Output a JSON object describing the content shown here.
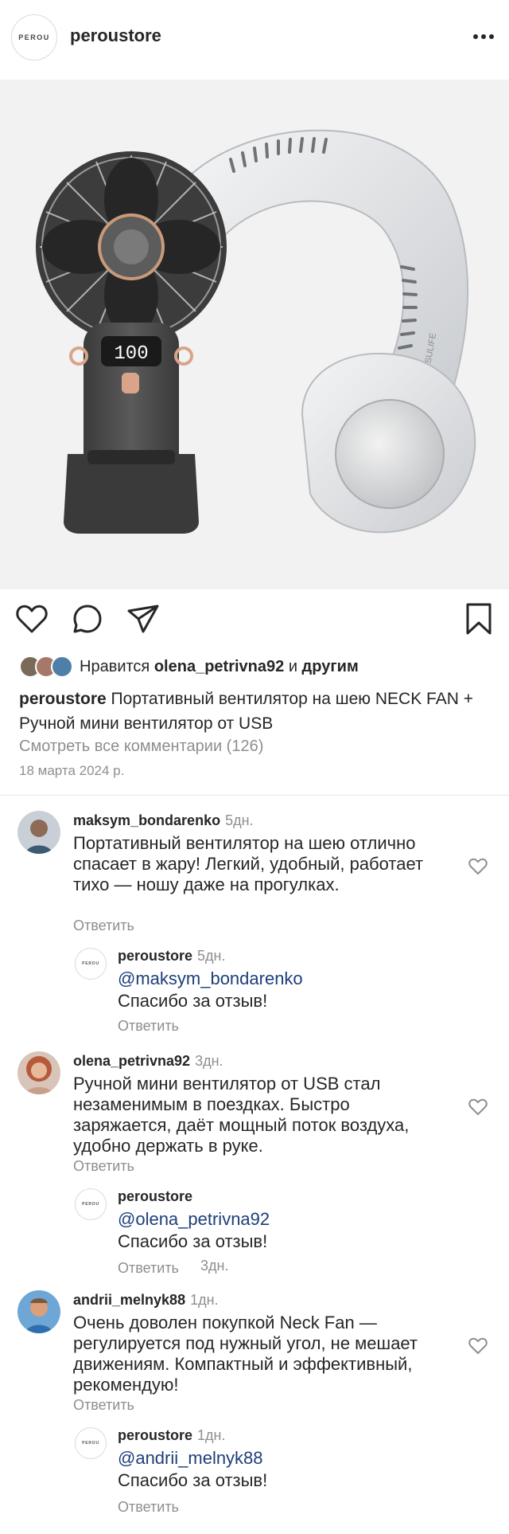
{
  "header": {
    "logo_text": "PEROU",
    "store_name": "peroustore",
    "more_icon": "more-horizontal-icon"
  },
  "product_image": {
    "display_digits": "100",
    "brand_on_fan": "JISULIFE"
  },
  "actions": {
    "like_icon": "heart-icon",
    "comment_icon": "comment-icon",
    "share_icon": "send-icon",
    "save_icon": "bookmark-icon"
  },
  "likes": {
    "prefix": "Нравится",
    "user": "olena_petrivna92",
    "connector": "и",
    "suffix": "другим"
  },
  "caption": {
    "user": "peroustore",
    "text": "Портативный вентилятор на шею NECK FAN + Ручной мини вентилятор от USB"
  },
  "view_all_comments": "Смотреть все комментарии (126)",
  "post_date": "18 марта 2024 р.",
  "comments": [
    {
      "user": "maksym_bondarenko",
      "time": "5дн.",
      "text": "Портативный вентилятор на шею отлично спасает в жару! Легкий, удобный, работает тихо — ношу даже на прогулках.",
      "reply_label": "Ответить",
      "reply": {
        "user": "peroustore",
        "time": "5дн.",
        "mention": "@maksym_bondarenko",
        "text": "Спасибо за отзыв!",
        "reply_label": "Ответить",
        "avatar_text": "PEROU"
      }
    },
    {
      "user": "olena_petrivna92",
      "time": "3дн.",
      "text": "Ручной мини вентилятор от USB стал незаменимым в поездках. Быстро заряжается, даёт мощный поток воздуха, удобно держать в руке.",
      "reply_label": "Ответить",
      "reply": {
        "user": "peroustore",
        "time": "3дн.",
        "mention": "@olena_petrivna92",
        "text": "Спасибо за отзыв!",
        "reply_label": "Ответить",
        "avatar_text": "PEROU"
      }
    },
    {
      "user": "andrii_melnyk88",
      "time": "1дн.",
      "text": "Очень доволен покупкой Neck Fan — регулируется под нужный угол, не мешает движениям. Компактный и эффективный, рекомендую!",
      "reply_label": "Ответить",
      "reply": {
        "user": "peroustore",
        "time": "1дн.",
        "mention": "@andrii_melnyk88",
        "text": "Спасибо за отзыв!",
        "reply_label": "Ответить",
        "avatar_text": "PEROU"
      }
    }
  ],
  "colors": {
    "link_blue": "#1c3f7a",
    "muted_gray": "#8e8e8e",
    "text": "#262626"
  }
}
